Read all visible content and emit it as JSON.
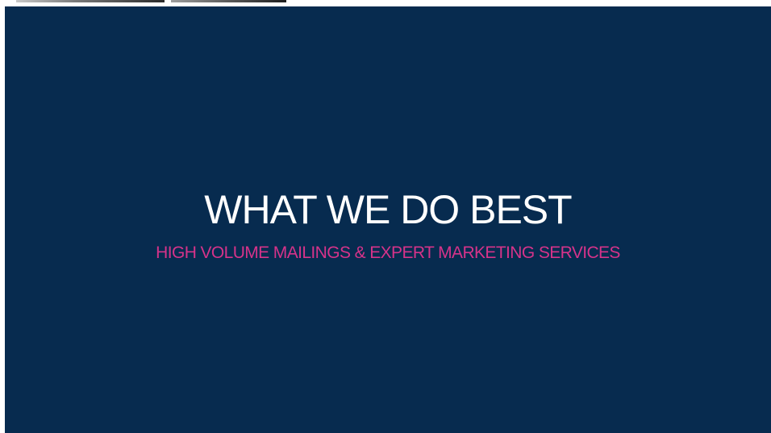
{
  "slide": {
    "title": "WHAT WE DO BEST",
    "subtitle": "HIGH VOLUME MAILINGS & EXPERT MARKETING SERVICES"
  },
  "colors": {
    "background": "#072b4f",
    "title": "#ffffff",
    "subtitle_accent": "#d6338a"
  }
}
